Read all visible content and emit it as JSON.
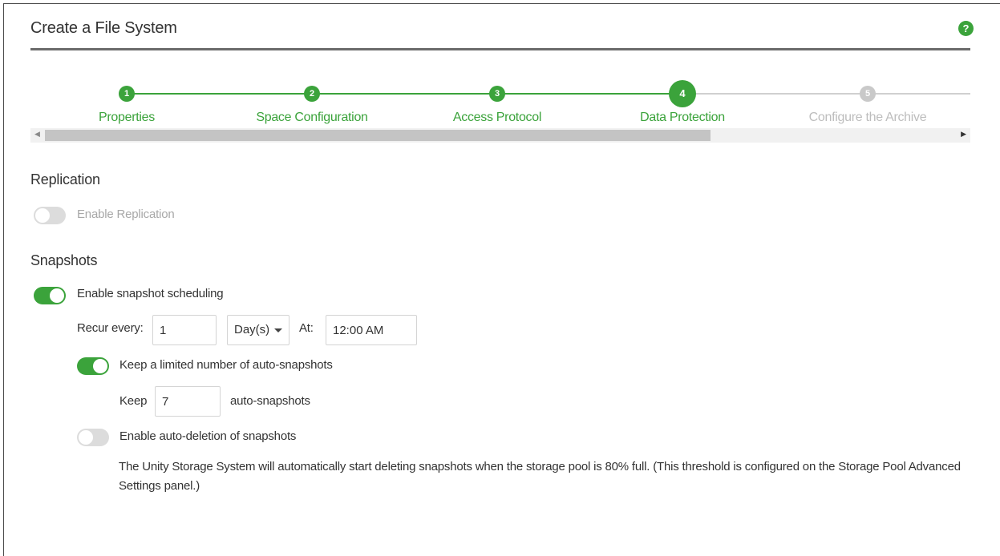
{
  "dialog": {
    "title": "Create a File System",
    "help_icon": "?"
  },
  "colors": {
    "accent": "#3ba33b",
    "inactive": "#c9c9c9",
    "toggle_off": "#dcdcdc"
  },
  "stepper": {
    "steps": [
      {
        "number": "1",
        "label": "Properties",
        "state": "complete"
      },
      {
        "number": "2",
        "label": "Space Configuration",
        "state": "complete"
      },
      {
        "number": "3",
        "label": "Access Protocol",
        "state": "complete"
      },
      {
        "number": "4",
        "label": "Data Protection",
        "state": "current"
      },
      {
        "number": "5",
        "label": "Configure the Archive",
        "state": "future"
      }
    ]
  },
  "replication": {
    "heading": "Replication",
    "enable_label": "Enable Replication",
    "enabled": false
  },
  "snapshots": {
    "heading": "Snapshots",
    "enable_scheduling_label": "Enable snapshot scheduling",
    "scheduling_enabled": true,
    "recur_label": "Recur every:",
    "recur_value": "1",
    "recur_unit": "Day(s)",
    "at_label": "At:",
    "at_value": "12:00 AM",
    "keep_limited_label": "Keep a limited number of auto-snapshots",
    "keep_limited_enabled": true,
    "keep_label": "Keep",
    "keep_value": "7",
    "keep_suffix": "auto-snapshots",
    "auto_delete_label": "Enable auto-deletion of snapshots",
    "auto_delete_enabled": false,
    "auto_delete_note": "The Unity Storage System will automatically start deleting snapshots when the storage pool is 80% full. (This threshold is configured on the Storage Pool Advanced Settings panel.)"
  }
}
